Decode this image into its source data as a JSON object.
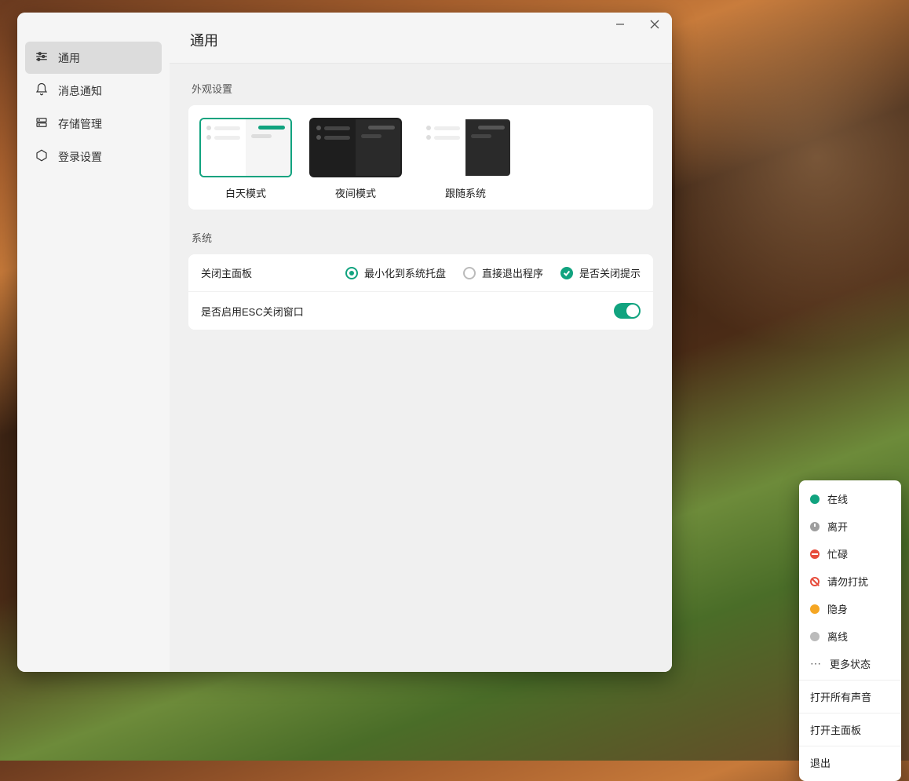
{
  "window": {
    "title": "通用"
  },
  "sidebar": {
    "items": [
      {
        "label": "通用",
        "icon": "sliders"
      },
      {
        "label": "消息通知",
        "icon": "bell"
      },
      {
        "label": "存储管理",
        "icon": "server"
      },
      {
        "label": "登录设置",
        "icon": "hexagon"
      }
    ]
  },
  "appearance": {
    "section_label": "外观设置",
    "themes": [
      {
        "label": "白天模式",
        "key": "day",
        "selected": true
      },
      {
        "label": "夜间模式",
        "key": "night",
        "selected": false
      },
      {
        "label": "跟随系统",
        "key": "system",
        "selected": false
      }
    ]
  },
  "system": {
    "section_label": "系统",
    "close_panel_label": "关闭主面板",
    "radios": [
      {
        "label": "最小化到系统托盘",
        "checked": true
      },
      {
        "label": "直接退出程序",
        "checked": false
      }
    ],
    "close_prompt_label": "是否关闭提示",
    "close_prompt_checked": true,
    "esc_label": "是否启用ESC关闭窗口",
    "esc_on": true
  },
  "context_menu": {
    "status_items": [
      {
        "label": "在线",
        "icon": "online"
      },
      {
        "label": "离开",
        "icon": "away"
      },
      {
        "label": "忙碌",
        "icon": "busy"
      },
      {
        "label": "请勿打扰",
        "icon": "dnd"
      },
      {
        "label": "隐身",
        "icon": "invisible"
      },
      {
        "label": "离线",
        "icon": "offline"
      }
    ],
    "more_label": "更多状态",
    "action_items": [
      {
        "label": "打开所有声音"
      },
      {
        "label": "打开主面板"
      },
      {
        "label": "退出"
      }
    ]
  }
}
